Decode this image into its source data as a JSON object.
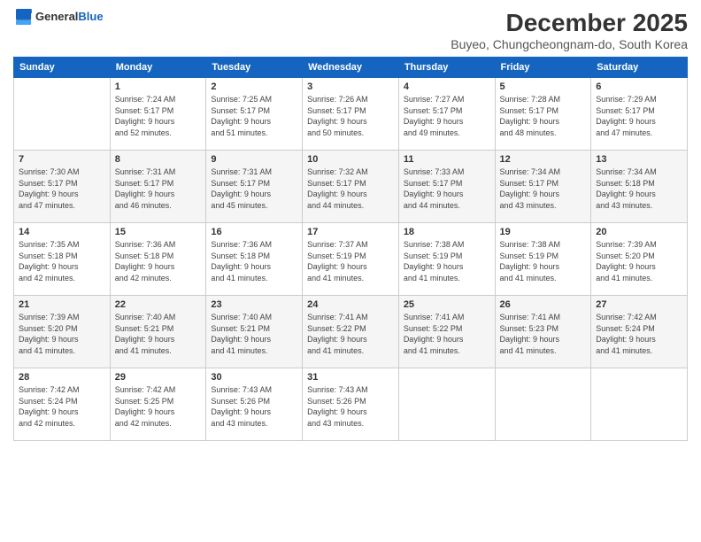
{
  "header": {
    "logo_general": "General",
    "logo_blue": "Blue",
    "title": "December 2025",
    "subtitle": "Buyeo, Chungcheongnam-do, South Korea"
  },
  "days_of_week": [
    "Sunday",
    "Monday",
    "Tuesday",
    "Wednesday",
    "Thursday",
    "Friday",
    "Saturday"
  ],
  "weeks": [
    [
      {
        "day": "",
        "info": ""
      },
      {
        "day": "1",
        "info": "Sunrise: 7:24 AM\nSunset: 5:17 PM\nDaylight: 9 hours\nand 52 minutes."
      },
      {
        "day": "2",
        "info": "Sunrise: 7:25 AM\nSunset: 5:17 PM\nDaylight: 9 hours\nand 51 minutes."
      },
      {
        "day": "3",
        "info": "Sunrise: 7:26 AM\nSunset: 5:17 PM\nDaylight: 9 hours\nand 50 minutes."
      },
      {
        "day": "4",
        "info": "Sunrise: 7:27 AM\nSunset: 5:17 PM\nDaylight: 9 hours\nand 49 minutes."
      },
      {
        "day": "5",
        "info": "Sunrise: 7:28 AM\nSunset: 5:17 PM\nDaylight: 9 hours\nand 48 minutes."
      },
      {
        "day": "6",
        "info": "Sunrise: 7:29 AM\nSunset: 5:17 PM\nDaylight: 9 hours\nand 47 minutes."
      }
    ],
    [
      {
        "day": "7",
        "info": "Sunrise: 7:30 AM\nSunset: 5:17 PM\nDaylight: 9 hours\nand 47 minutes."
      },
      {
        "day": "8",
        "info": "Sunrise: 7:31 AM\nSunset: 5:17 PM\nDaylight: 9 hours\nand 46 minutes."
      },
      {
        "day": "9",
        "info": "Sunrise: 7:31 AM\nSunset: 5:17 PM\nDaylight: 9 hours\nand 45 minutes."
      },
      {
        "day": "10",
        "info": "Sunrise: 7:32 AM\nSunset: 5:17 PM\nDaylight: 9 hours\nand 44 minutes."
      },
      {
        "day": "11",
        "info": "Sunrise: 7:33 AM\nSunset: 5:17 PM\nDaylight: 9 hours\nand 44 minutes."
      },
      {
        "day": "12",
        "info": "Sunrise: 7:34 AM\nSunset: 5:17 PM\nDaylight: 9 hours\nand 43 minutes."
      },
      {
        "day": "13",
        "info": "Sunrise: 7:34 AM\nSunset: 5:18 PM\nDaylight: 9 hours\nand 43 minutes."
      }
    ],
    [
      {
        "day": "14",
        "info": "Sunrise: 7:35 AM\nSunset: 5:18 PM\nDaylight: 9 hours\nand 42 minutes."
      },
      {
        "day": "15",
        "info": "Sunrise: 7:36 AM\nSunset: 5:18 PM\nDaylight: 9 hours\nand 42 minutes."
      },
      {
        "day": "16",
        "info": "Sunrise: 7:36 AM\nSunset: 5:18 PM\nDaylight: 9 hours\nand 41 minutes."
      },
      {
        "day": "17",
        "info": "Sunrise: 7:37 AM\nSunset: 5:19 PM\nDaylight: 9 hours\nand 41 minutes."
      },
      {
        "day": "18",
        "info": "Sunrise: 7:38 AM\nSunset: 5:19 PM\nDaylight: 9 hours\nand 41 minutes."
      },
      {
        "day": "19",
        "info": "Sunrise: 7:38 AM\nSunset: 5:19 PM\nDaylight: 9 hours\nand 41 minutes."
      },
      {
        "day": "20",
        "info": "Sunrise: 7:39 AM\nSunset: 5:20 PM\nDaylight: 9 hours\nand 41 minutes."
      }
    ],
    [
      {
        "day": "21",
        "info": "Sunrise: 7:39 AM\nSunset: 5:20 PM\nDaylight: 9 hours\nand 41 minutes."
      },
      {
        "day": "22",
        "info": "Sunrise: 7:40 AM\nSunset: 5:21 PM\nDaylight: 9 hours\nand 41 minutes."
      },
      {
        "day": "23",
        "info": "Sunrise: 7:40 AM\nSunset: 5:21 PM\nDaylight: 9 hours\nand 41 minutes."
      },
      {
        "day": "24",
        "info": "Sunrise: 7:41 AM\nSunset: 5:22 PM\nDaylight: 9 hours\nand 41 minutes."
      },
      {
        "day": "25",
        "info": "Sunrise: 7:41 AM\nSunset: 5:22 PM\nDaylight: 9 hours\nand 41 minutes."
      },
      {
        "day": "26",
        "info": "Sunrise: 7:41 AM\nSunset: 5:23 PM\nDaylight: 9 hours\nand 41 minutes."
      },
      {
        "day": "27",
        "info": "Sunrise: 7:42 AM\nSunset: 5:24 PM\nDaylight: 9 hours\nand 41 minutes."
      }
    ],
    [
      {
        "day": "28",
        "info": "Sunrise: 7:42 AM\nSunset: 5:24 PM\nDaylight: 9 hours\nand 42 minutes."
      },
      {
        "day": "29",
        "info": "Sunrise: 7:42 AM\nSunset: 5:25 PM\nDaylight: 9 hours\nand 42 minutes."
      },
      {
        "day": "30",
        "info": "Sunrise: 7:43 AM\nSunset: 5:26 PM\nDaylight: 9 hours\nand 43 minutes."
      },
      {
        "day": "31",
        "info": "Sunrise: 7:43 AM\nSunset: 5:26 PM\nDaylight: 9 hours\nand 43 minutes."
      },
      {
        "day": "",
        "info": ""
      },
      {
        "day": "",
        "info": ""
      },
      {
        "day": "",
        "info": ""
      }
    ]
  ]
}
